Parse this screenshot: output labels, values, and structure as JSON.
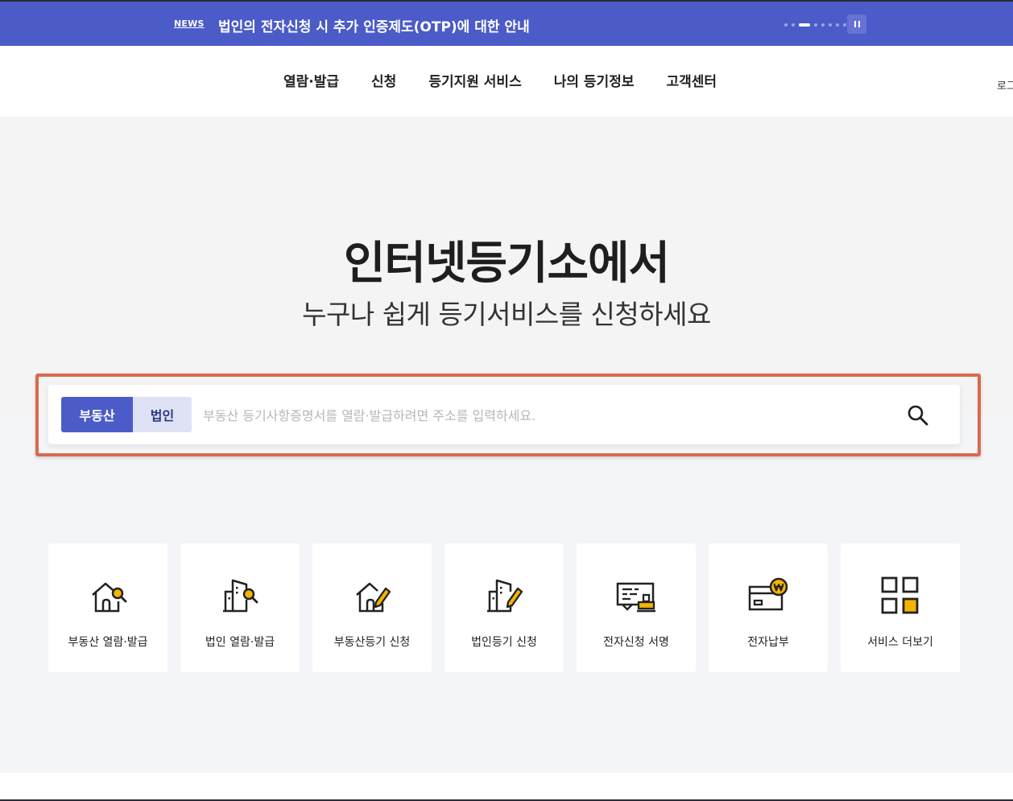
{
  "news": {
    "tag": "NEWS",
    "headline": "법인의 전자신청 시 추가 인증제도(OTP)에 대한 안내",
    "slides_total": 8,
    "slide_active_index": 2
  },
  "nav": {
    "items": [
      {
        "label": "열람·발급"
      },
      {
        "label": "신청"
      },
      {
        "label": "등기지원 서비스"
      },
      {
        "label": "나의 등기정보"
      },
      {
        "label": "고객센터"
      }
    ],
    "login_label": "로그"
  },
  "hero": {
    "title": "인터넷등기소에서",
    "subtitle": "누구나 쉽게 등기서비스를 신청하세요"
  },
  "search": {
    "tabs": [
      {
        "label": "부동산",
        "selected": true
      },
      {
        "label": "법인",
        "selected": false
      }
    ],
    "placeholder": "부동산 등기사항증명서를 열람·발급하려면 주소를 입력하세요.",
    "value": ""
  },
  "services": [
    {
      "label": "부동산 열람·발급",
      "icon": "house-search-icon"
    },
    {
      "label": "법인 열람·발급",
      "icon": "building-search-icon"
    },
    {
      "label": "부동산등기 신청",
      "icon": "house-pen-icon"
    },
    {
      "label": "법인등기 신청",
      "icon": "building-pen-icon"
    },
    {
      "label": "전자신청 서명",
      "icon": "document-stamp-icon"
    },
    {
      "label": "전자납부",
      "icon": "card-won-icon"
    },
    {
      "label": "서비스 더보기",
      "icon": "grid-more-icon"
    }
  ],
  "colors": {
    "brand": "#4b5bc8",
    "accent": "#f4b400",
    "highlight_border": "#d9694b"
  }
}
